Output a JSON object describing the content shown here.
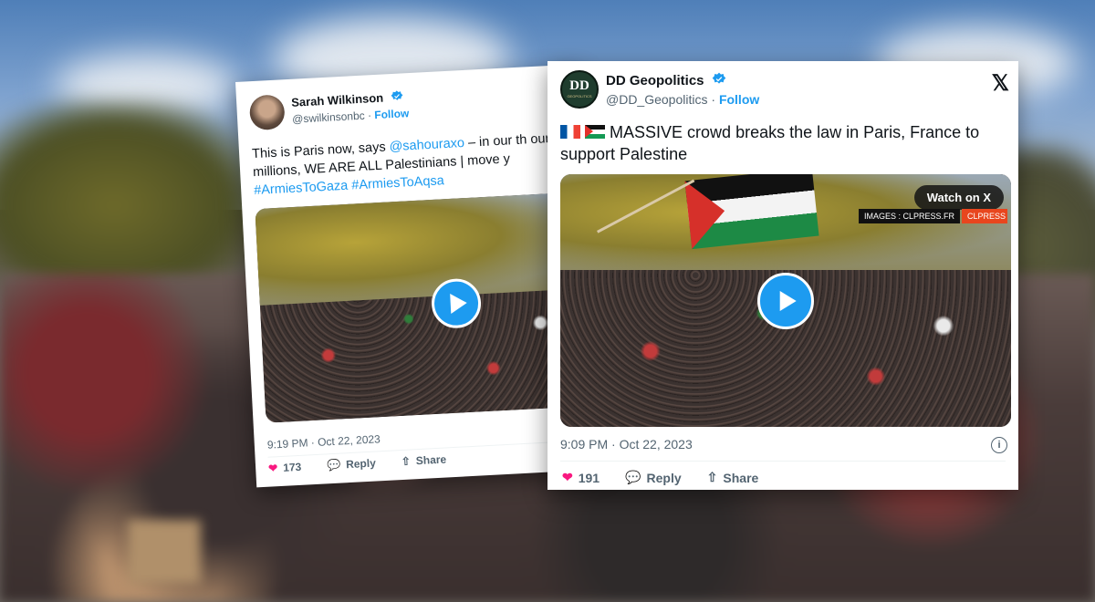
{
  "tweet1": {
    "name": "Sarah Wilkinson",
    "handle": "@swilkinsonbc",
    "separator": "·",
    "follow": "Follow",
    "text_pre": "This is Paris now, says ",
    "mention": "@sahouraxo",
    "text_post": " – in our th our millions, WE ARE ALL Palestinians | move y",
    "hashtag1": "#ArmiesToGaza",
    "hashtag2": "#ArmiesToAqsa",
    "timestamp": "9:19 PM · Oct 22, 2023",
    "likes": "173",
    "reply": "Reply",
    "share": "Share"
  },
  "tweet2": {
    "avatar_text": "DD",
    "avatar_sub": "GEOPOLITICS",
    "name": "DD Geopolitics",
    "handle": "@DD_Geopolitics",
    "separator": "·",
    "follow": "Follow",
    "text": "MASSIVE crowd breaks the law in Paris, France to support Palestine",
    "watch_label": "Watch on X",
    "image_credit": "IMAGES : CLPRESS.FR",
    "credit_logo": "CLPRESS",
    "timestamp": "9:09 PM · Oct 22, 2023",
    "likes": "191",
    "reply": "Reply",
    "share": "Share",
    "x_logo": "𝕏",
    "info": "i"
  },
  "colors": {
    "accent": "#1d9bf0",
    "like": "#f91880",
    "text": "#0f1419",
    "secondary": "#536471"
  }
}
